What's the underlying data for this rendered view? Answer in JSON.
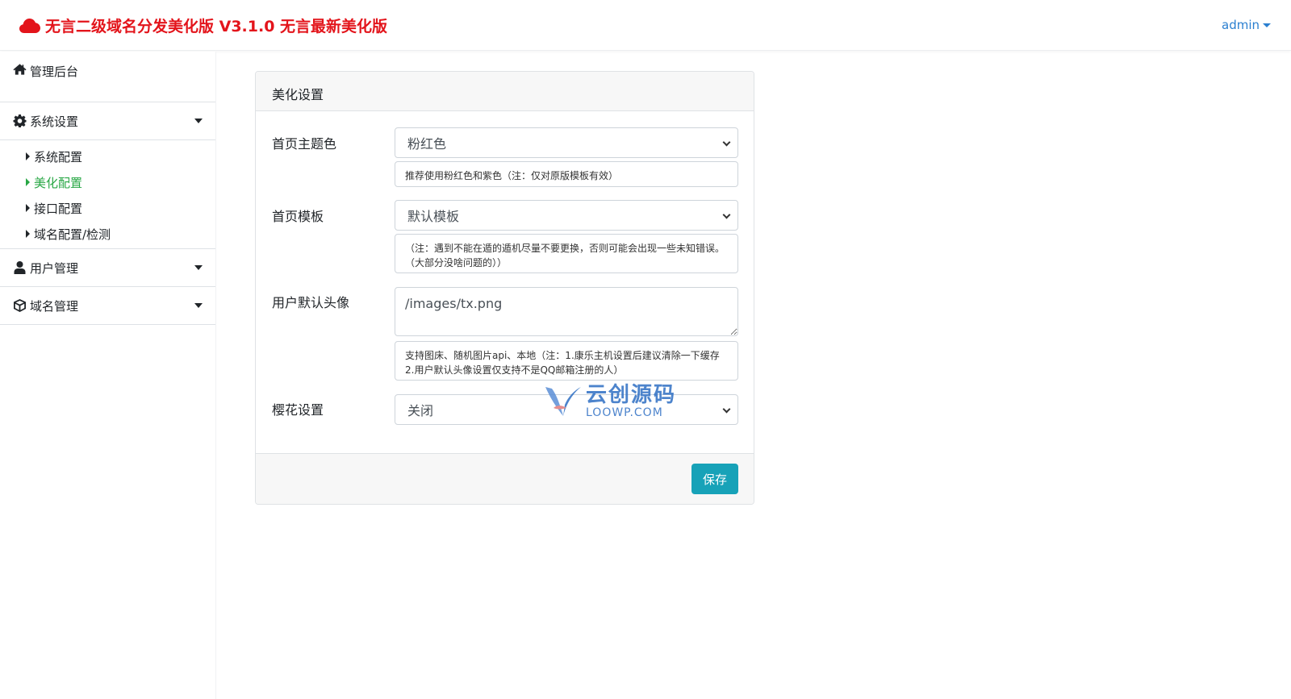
{
  "header": {
    "brand": "无言二级域名分发美化版 V3.1.0 无言最新美化版",
    "user": "admin",
    "brand_color": "#e3141b",
    "link_color": "#2a7fd0"
  },
  "sidebar": {
    "dashboard": "管理后台",
    "system": {
      "label": "系统设置",
      "items": [
        "系统配置",
        "美化配置",
        "接口配置",
        "域名配置/检测"
      ],
      "active": "美化配置"
    },
    "users": "用户管理",
    "domains": "域名管理",
    "active_color": "#28a745"
  },
  "card": {
    "title": "美化设置",
    "fields": {
      "theme": {
        "label": "首页主题色",
        "value": "粉红色",
        "hint": "推荐使用粉红色和紫色（注：仅对原版模板有效）"
      },
      "template": {
        "label": "首页模板",
        "value": "默认模板",
        "hint": "（注：遇到不能在遁的遁机尽量不要更换，否则可能会出现一些未知错误。（大部分没啥问题的））"
      },
      "avatar": {
        "label": "用户默认头像",
        "value": "/images/tx.png",
        "hint": "支持图床、随机图片api、本地（注：1.康乐主机设置后建议清除一下缓存 2.用户默认头像设置仅支持不是QQ邮箱注册的人）"
      },
      "sakura": {
        "label": "樱花设置",
        "value": "关闭"
      }
    },
    "save_label": "保存",
    "save_color": "#17a2b8"
  },
  "watermark": {
    "title": "云创源码",
    "sub": "LOOWP.COM"
  }
}
